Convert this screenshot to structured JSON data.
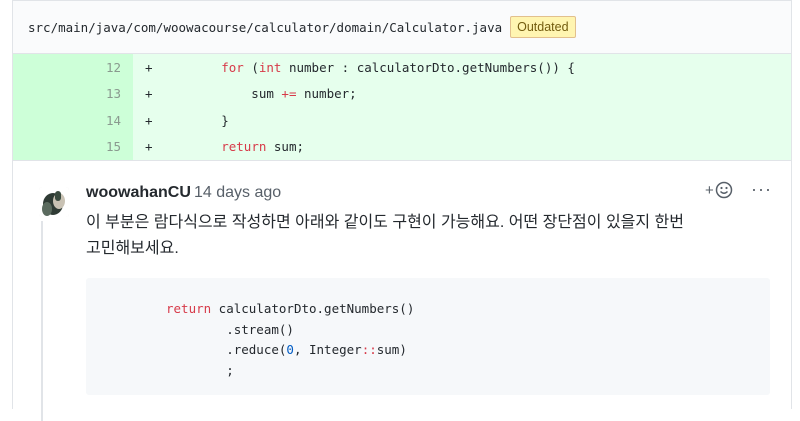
{
  "file": {
    "path": "src/main/java/com/woowacourse/calculator/domain/Calculator.java",
    "badge": "Outdated"
  },
  "diff": {
    "lines": [
      {
        "num": "12",
        "sign": "+",
        "parts": [
          {
            "t": "        "
          },
          {
            "t": "for",
            "k": "kw"
          },
          {
            "t": " ("
          },
          {
            "t": "int",
            "k": "kw"
          },
          {
            "t": " number : calculatorDto.getNumbers()) {"
          }
        ]
      },
      {
        "num": "13",
        "sign": "+",
        "parts": [
          {
            "t": "            sum "
          },
          {
            "t": "+=",
            "k": "op"
          },
          {
            "t": " number;"
          }
        ]
      },
      {
        "num": "14",
        "sign": "+",
        "parts": [
          {
            "t": "        }"
          }
        ]
      },
      {
        "num": "15",
        "sign": "+",
        "parts": [
          {
            "t": "        "
          },
          {
            "t": "return",
            "k": "kw"
          },
          {
            "t": " sum;"
          }
        ]
      }
    ]
  },
  "comment": {
    "author": "woowahanCU",
    "time": "14 days ago",
    "react_label": "+",
    "react_icon": "smiley-icon",
    "more_label": "···",
    "body_line1": "이 부분은 람다식으로 작성하면 아래와 같이도 구현이 가능해요. 어떤 장단점이 있을지 한번",
    "body_line2": "고민해보세요.",
    "code": [
      {
        "parts": [
          {
            "t": "return",
            "k": "kw"
          },
          {
            "t": " calculatorDto.getNumbers()"
          }
        ]
      },
      {
        "parts": [
          {
            "t": "        .stream()"
          }
        ]
      },
      {
        "parts": [
          {
            "t": "        .reduce("
          },
          {
            "t": "0",
            "k": "num"
          },
          {
            "t": ", Integer"
          },
          {
            "t": "::",
            "k": "op"
          },
          {
            "t": "sum)"
          }
        ]
      },
      {
        "parts": [
          {
            "t": "        ;"
          }
        ]
      }
    ]
  }
}
